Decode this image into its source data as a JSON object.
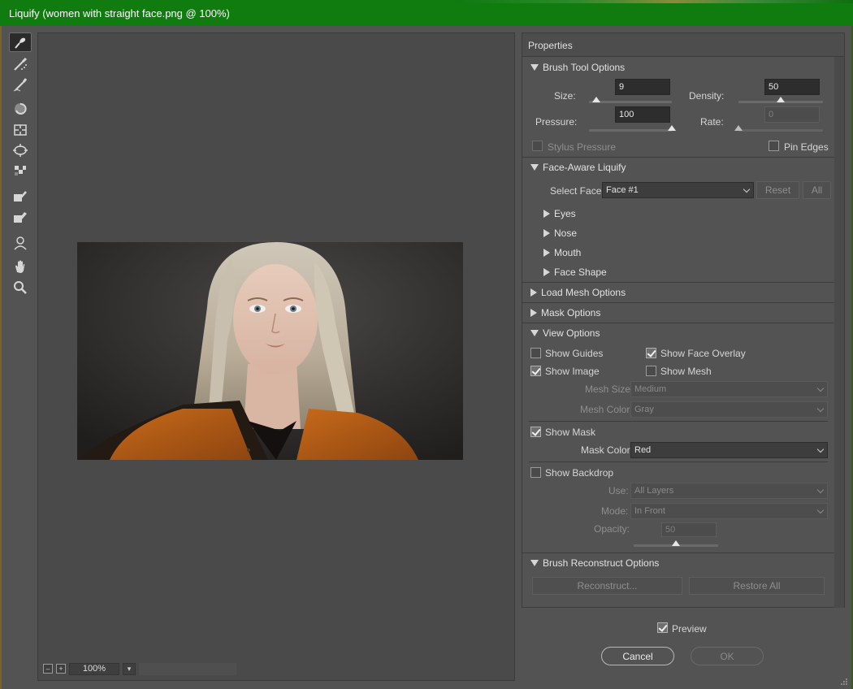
{
  "window": {
    "title": "Liquify (women with straight face.png @ 100%)"
  },
  "toolbar": {
    "tools": [
      "forward-warp",
      "reconstruct",
      "smooth",
      "twirl",
      "pucker",
      "bloat",
      "push-left",
      "freeze-mask",
      "thaw-mask",
      "face",
      "hand",
      "zoom"
    ]
  },
  "canvas": {
    "zoom": "100%",
    "zoom_minus": "–",
    "zoom_plus": "+"
  },
  "properties": {
    "title": "Properties",
    "brush_tool_options": {
      "title": "Brush Tool Options",
      "size_label": "Size:",
      "size_value": "9",
      "size_level": 0.09,
      "density_label": "Density:",
      "density_value": "50",
      "density_level": 0.5,
      "pressure_label": "Pressure:",
      "pressure_value": "100",
      "pressure_level": 1.0,
      "rate_label": "Rate:",
      "rate_value": "0",
      "rate_level": 0.0,
      "stylus_pressure": "Stylus Pressure",
      "pin_edges": "Pin Edges"
    },
    "face_aware": {
      "title": "Face-Aware Liquify",
      "select_face_label": "Select Face:",
      "select_face_value": "Face #1",
      "reset": "Reset",
      "all": "All",
      "items": [
        "Eyes",
        "Nose",
        "Mouth",
        "Face Shape"
      ]
    },
    "load_mesh": {
      "title": "Load Mesh Options"
    },
    "mask_options": {
      "title": "Mask Options"
    },
    "view_options": {
      "title": "View Options",
      "show_guides": "Show Guides",
      "show_face_overlay": "Show Face Overlay",
      "show_image": "Show Image",
      "show_mesh": "Show Mesh",
      "mesh_size_label": "Mesh Size:",
      "mesh_size_value": "Medium",
      "mesh_color_label": "Mesh Color:",
      "mesh_color_value": "Gray",
      "show_mask": "Show Mask",
      "mask_color_label": "Mask Color:",
      "mask_color_value": "Red",
      "show_backdrop": "Show Backdrop",
      "use_label": "Use:",
      "use_value": "All Layers",
      "mode_label": "Mode:",
      "mode_value": "In Front",
      "opacity_label": "Opacity:",
      "opacity_value": "50",
      "opacity_level": 0.5
    },
    "reconstruct_options": {
      "title": "Brush Reconstruct Options",
      "reconstruct": "Reconstruct...",
      "restore_all": "Restore All"
    }
  },
  "footer": {
    "preview": "Preview",
    "cancel": "Cancel",
    "ok": "OK"
  },
  "colors": {
    "title_bar": "#107c10",
    "panel": "#535353",
    "canvas": "#4a4a4a"
  }
}
